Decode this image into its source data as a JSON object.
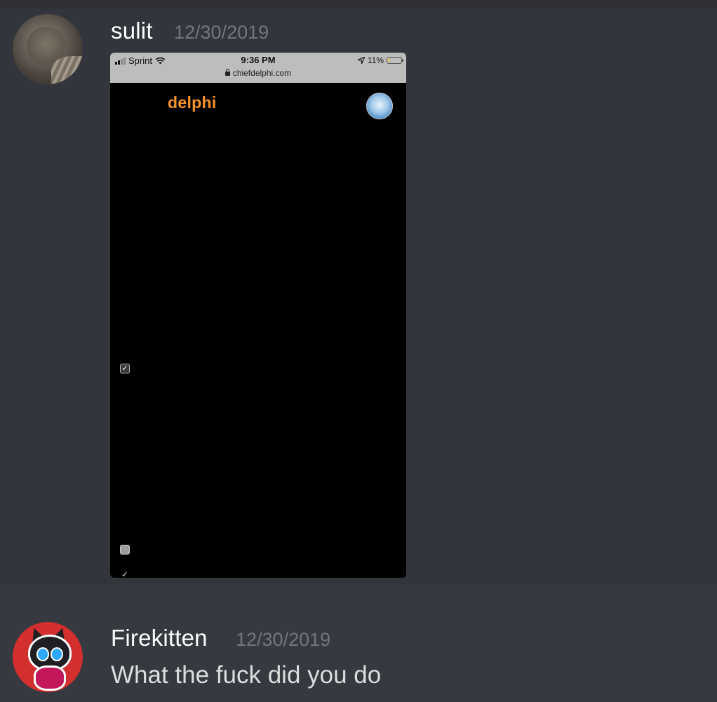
{
  "messages": [
    {
      "username": "sulit",
      "timestamp": "12/30/2019",
      "attachment": {
        "status_bar": {
          "carrier": "Sprint",
          "time": "9:36 PM",
          "url": "chiefdelphi.com",
          "battery": "11%",
          "battery_level": 0.11
        },
        "site_logo": "delphi",
        "checkmark_glyph": "✓"
      }
    },
    {
      "username": "Firekitten",
      "timestamp": "12/30/2019",
      "text": "What the fuck did you do"
    }
  ]
}
